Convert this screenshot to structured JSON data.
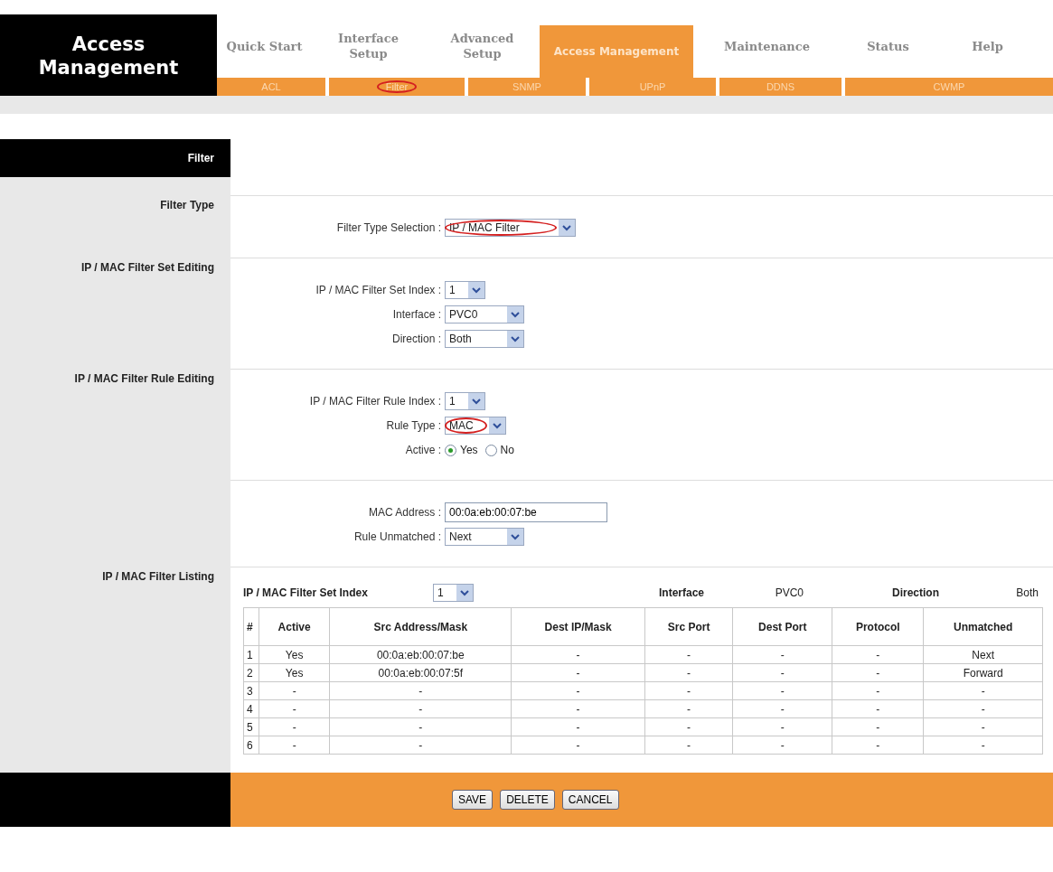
{
  "sidebar_title": "Access Management",
  "tabs": [
    {
      "label": "Quick Start",
      "selected": false
    },
    {
      "label": "Interface Setup",
      "selected": false
    },
    {
      "label": "Advanced Setup",
      "selected": false
    },
    {
      "label": "Access Management",
      "selected": true
    },
    {
      "label": "Maintenance",
      "selected": false
    },
    {
      "label": "Status",
      "selected": false
    },
    {
      "label": "Help",
      "selected": false
    }
  ],
  "subtabs": [
    {
      "label": "ACL",
      "circled": false
    },
    {
      "label": "Filter",
      "circled": true
    },
    {
      "label": "SNMP",
      "circled": false
    },
    {
      "label": "UPnP",
      "circled": false
    },
    {
      "label": "DDNS",
      "circled": false
    },
    {
      "label": "CWMP",
      "circled": false
    }
  ],
  "section_title": "Filter",
  "sections": [
    {
      "label": "Filter Type",
      "fields": [
        {
          "kind": "select",
          "label": "Filter Type Selection :",
          "value": "IP / MAC Filter",
          "circled": true
        }
      ]
    },
    {
      "label": "IP / MAC Filter Set Editing",
      "fields": [
        {
          "kind": "select",
          "label": "IP / MAC Filter Set Index :",
          "value": "1",
          "circled": false
        },
        {
          "kind": "select",
          "label": "Interface :",
          "value": "PVC0",
          "circled": false
        },
        {
          "kind": "select",
          "label": "Direction :",
          "value": "Both",
          "circled": false
        }
      ]
    },
    {
      "label": "IP / MAC Filter Rule Editing",
      "fields": [
        {
          "kind": "select",
          "label": "IP / MAC Filter Rule Index :",
          "value": "1",
          "circled": false
        },
        {
          "kind": "select",
          "label": "Rule Type :",
          "value": "MAC",
          "circled": true
        },
        {
          "kind": "radio",
          "label": "Active :",
          "options": [
            {
              "label": "Yes",
              "selected": true
            },
            {
              "label": "No",
              "selected": false
            }
          ]
        }
      ]
    },
    {
      "fields": [
        {
          "kind": "text",
          "label": "MAC Address :",
          "value": "00:0a:eb:00:07:be"
        },
        {
          "kind": "select",
          "label": "Rule Unmatched :",
          "value": "Next",
          "circled": false
        }
      ]
    }
  ],
  "listing": {
    "label": "IP / MAC Filter Listing",
    "set_index_label": "IP / MAC Filter Set Index",
    "set_index_value": "1",
    "interface_label": "Interface",
    "interface_value": "PVC0",
    "direction_label": "Direction",
    "direction_value": "Both",
    "columns": [
      "#",
      "Active",
      "Src Address/Mask",
      "Dest IP/Mask",
      "Src Port",
      "Dest Port",
      "Protocol",
      "Unmatched"
    ],
    "rows": [
      [
        "1",
        "Yes",
        "00:0a:eb:00:07:be",
        "-",
        "-",
        "-",
        "-",
        "Next"
      ],
      [
        "2",
        "Yes",
        "00:0a:eb:00:07:5f",
        "-",
        "-",
        "-",
        "-",
        "Forward"
      ],
      [
        "3",
        "-",
        "-",
        "-",
        "-",
        "-",
        "-",
        "-"
      ],
      [
        "4",
        "-",
        "-",
        "-",
        "-",
        "-",
        "-",
        "-"
      ],
      [
        "5",
        "-",
        "-",
        "-",
        "-",
        "-",
        "-",
        "-"
      ],
      [
        "6",
        "-",
        "-",
        "-",
        "-",
        "-",
        "-",
        "-"
      ]
    ]
  },
  "buttons": [
    "SAVE",
    "DELETE",
    "CANCEL"
  ]
}
